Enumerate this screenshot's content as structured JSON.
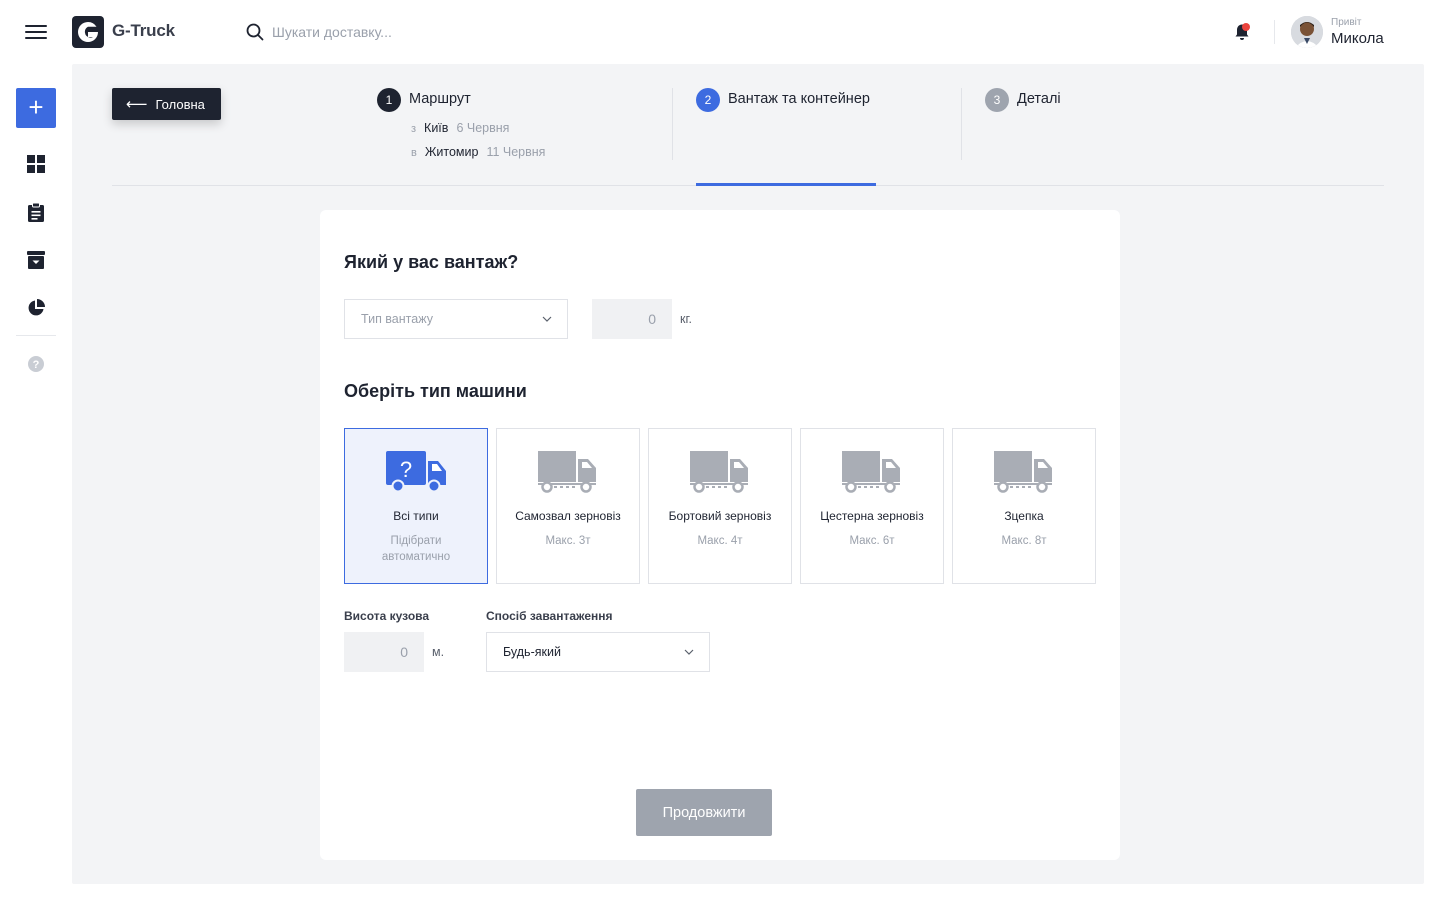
{
  "app": {
    "name": "G-Truck"
  },
  "search": {
    "placeholder": "Шукати доставку..."
  },
  "user": {
    "greeting": "Привіт",
    "name": "Микола"
  },
  "nav": {
    "back_label": "Головна"
  },
  "steps": [
    {
      "number": "1",
      "title": "Маршрут",
      "state": "done"
    },
    {
      "number": "2",
      "title": "Вантаж та контейнер",
      "state": "active"
    },
    {
      "number": "3",
      "title": "Деталі",
      "state": "pending"
    }
  ],
  "route": {
    "from": {
      "prefix": "з",
      "city": "Київ",
      "date": "6 Червня"
    },
    "to": {
      "prefix": "в",
      "city": "Житомир",
      "date": "11 Червня"
    }
  },
  "cargo": {
    "heading": "Який у вас вантаж?",
    "type_placeholder": "Тип вантажу",
    "weight_value": "0",
    "weight_unit": "кг."
  },
  "vehicle": {
    "heading": "Оберіть тип машини",
    "types": [
      {
        "name": "Всі типи",
        "sub": "Підібрати автоматично",
        "selected": true,
        "icon": "truck-question-icon"
      },
      {
        "name": "Самозвал зерновіз",
        "sub": "Макс. 3т",
        "selected": false,
        "icon": "truck-icon"
      },
      {
        "name": "Бортовий зерновіз",
        "sub": "Макс. 4т",
        "selected": false,
        "icon": "truck-icon"
      },
      {
        "name": "Цестерна зерновіз",
        "sub": "Макс. 6т",
        "selected": false,
        "icon": "truck-icon"
      },
      {
        "name": "Зцепка",
        "sub": "Макс. 8т",
        "selected": false,
        "icon": "truck-icon"
      }
    ]
  },
  "body_height": {
    "label": "Висота кузова",
    "value": "0",
    "unit": "м."
  },
  "loading": {
    "label": "Спосіб завантаження",
    "value": "Будь-який"
  },
  "actions": {
    "continue_label": "Продовжити"
  },
  "colors": {
    "accent": "#3d6be0",
    "dark": "#1e2330",
    "disabled": "#9ea4ae",
    "notification": "#e9433d"
  }
}
